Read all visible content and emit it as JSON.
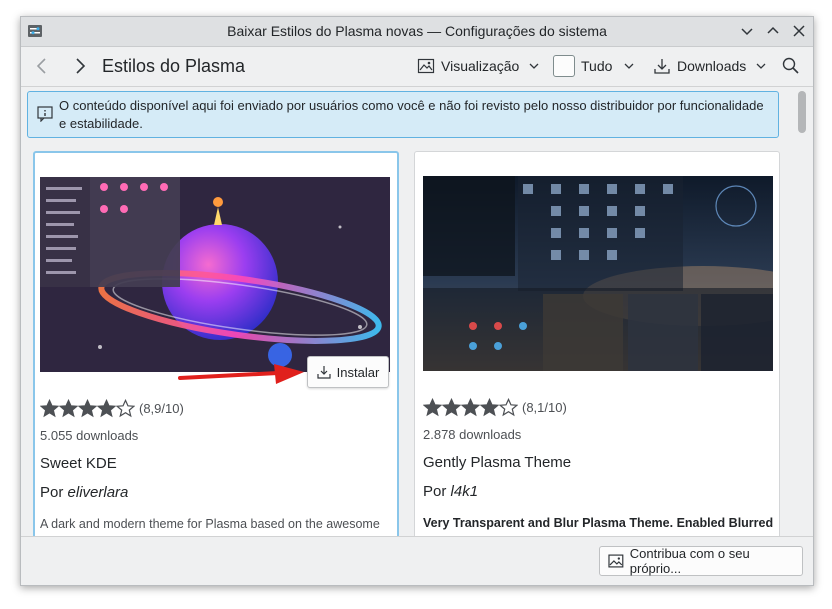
{
  "window": {
    "title": "Baixar Estilos do Plasma novas — Configurações do sistema"
  },
  "toolbar": {
    "page_title": "Estilos do Plasma",
    "view_label": "Visualização",
    "filter_label": "Tudo",
    "sort_label": "Downloads"
  },
  "notice": {
    "text": "O conteúdo disponível aqui foi enviado por usuários como você e não foi revisto pelo nosso distribuidor por funcionalidade e estabilidade."
  },
  "items": [
    {
      "rating_text": "(8,9/10)",
      "stars": 4,
      "downloads": "5.055 downloads",
      "name": "Sweet KDE",
      "author_prefix": "Por",
      "author": "eliverlara",
      "description": "A dark and modern theme for Plasma based on the awesome",
      "install_label": "Instalar"
    },
    {
      "rating_text": "(8,1/10)",
      "stars": 4,
      "downloads": "2.878 downloads",
      "name": "Gently Plasma Theme",
      "author_prefix": "Por",
      "author": "l4k1",
      "description": "Very Transparent and Blur Plasma Theme. Enabled Blurred"
    }
  ],
  "footer": {
    "contribute_label": "Contribua com o seu próprio..."
  },
  "colors": {
    "accent": "#3daee9",
    "notice_bg": "#d5ebf7",
    "arrow": "#e0201c"
  }
}
